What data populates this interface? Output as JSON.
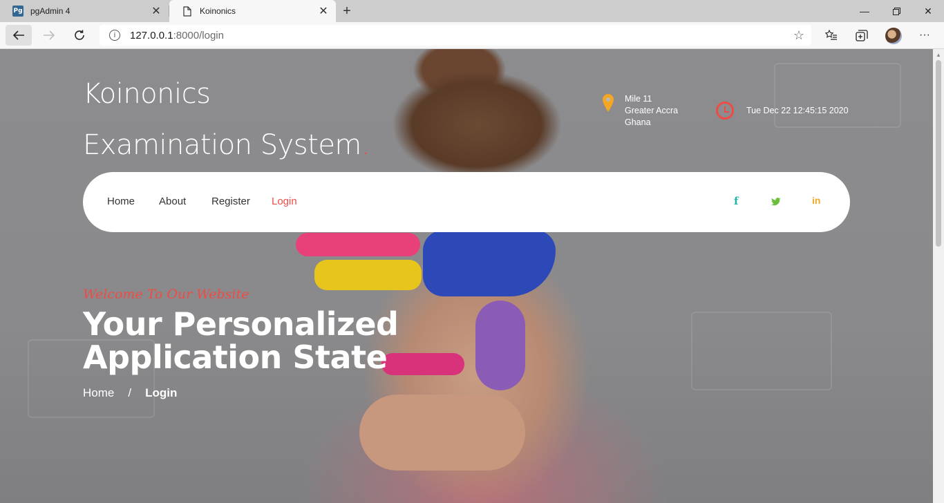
{
  "browser": {
    "tabs": [
      {
        "title": "pgAdmin 4",
        "favicon": "Pg"
      },
      {
        "title": "Koinonics"
      }
    ],
    "url_host": "127.0.0.1",
    "url_path": ":8000/login"
  },
  "site": {
    "brand": "Koinonics Examination System",
    "brand_dot": ".",
    "location": [
      "Mile 11",
      "Greater Accra",
      "Ghana"
    ],
    "datetime": "Tue Dec 22 12:45:15 2020",
    "nav": [
      "Home",
      "About",
      "Register",
      "Login"
    ],
    "social": [
      "f",
      "t",
      "in"
    ],
    "welcome": "Welcome To Our Website",
    "hero_line1": "Your Personalized",
    "hero_line2": "Application State",
    "breadcrumb": {
      "home": "Home",
      "separator": "/",
      "current": "Login"
    }
  },
  "colors": {
    "accent": "#ef4b45",
    "pin": "#f5a623",
    "facebook": "#1fb5a5",
    "twitter": "#6bbf3a",
    "linkedin": "#f5a623"
  }
}
